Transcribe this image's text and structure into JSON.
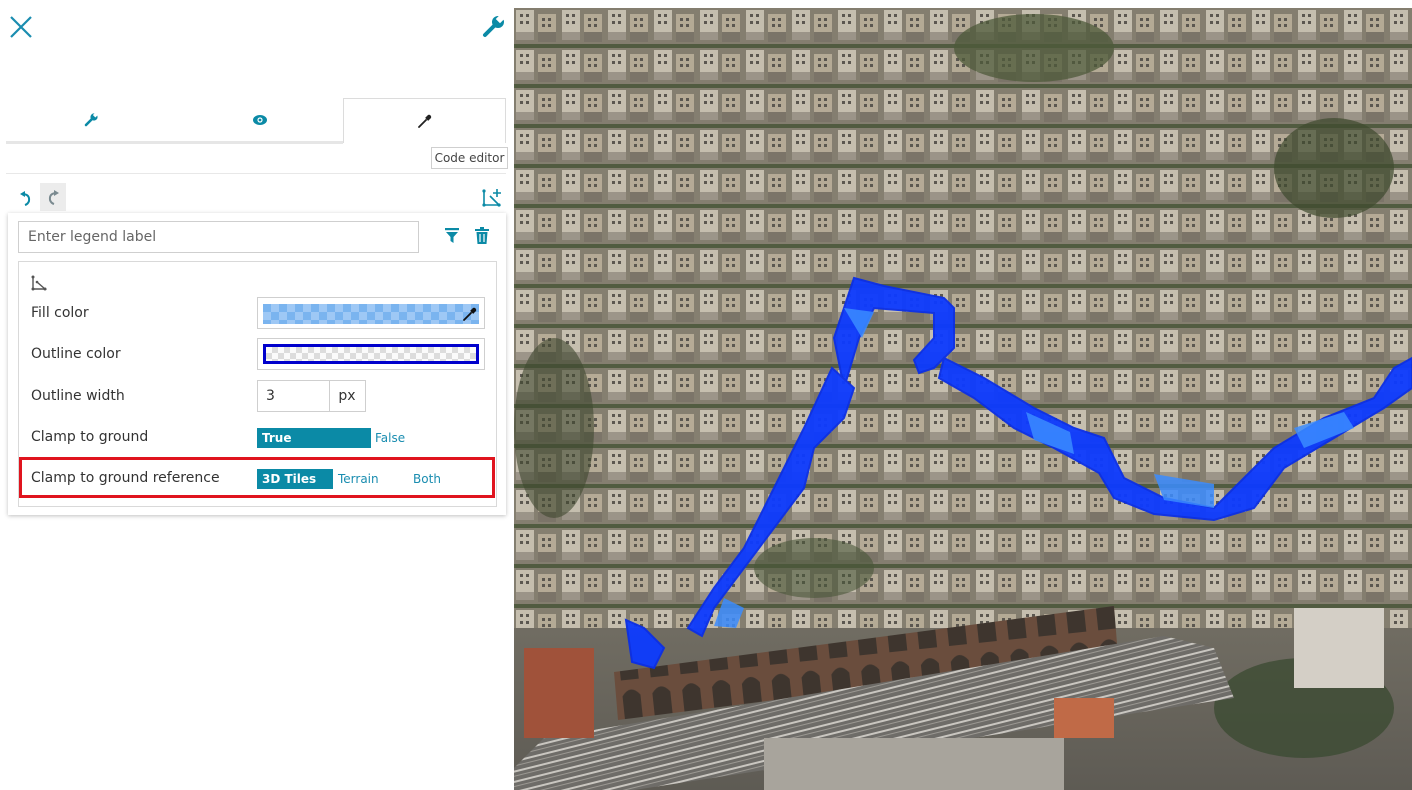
{
  "panel": {
    "tabs": [
      {
        "name": "style-settings",
        "icon": "wrench-icon"
      },
      {
        "name": "visibility",
        "icon": "eye-icon"
      },
      {
        "name": "style-editor",
        "icon": "eyedropper-icon",
        "active": true
      }
    ],
    "code_editor_label": "Code editor",
    "legend_placeholder": "Enter legend label",
    "fill_color_label": "Fill color",
    "outline_color_label": "Outline color",
    "outline_width_label": "Outline width",
    "outline_width_value": "3",
    "outline_width_unit": "px",
    "clamp_label": "Clamp to ground",
    "clamp_options": {
      "true_label": "True",
      "false_label": "False",
      "selected": "True"
    },
    "clamp_ref_label": "Clamp to ground reference",
    "clamp_ref_options": {
      "tiles_label": "3D Tiles",
      "terrain_label": "Terrain",
      "both_label": "Both",
      "selected": "3D Tiles"
    }
  },
  "colors": {
    "accent": "#0b8aa6",
    "fill": "#7ab4ef",
    "outline": "#0000cc",
    "highlight": "#e0141e"
  },
  "map": {
    "description_icon": "3d-map-viewport"
  }
}
